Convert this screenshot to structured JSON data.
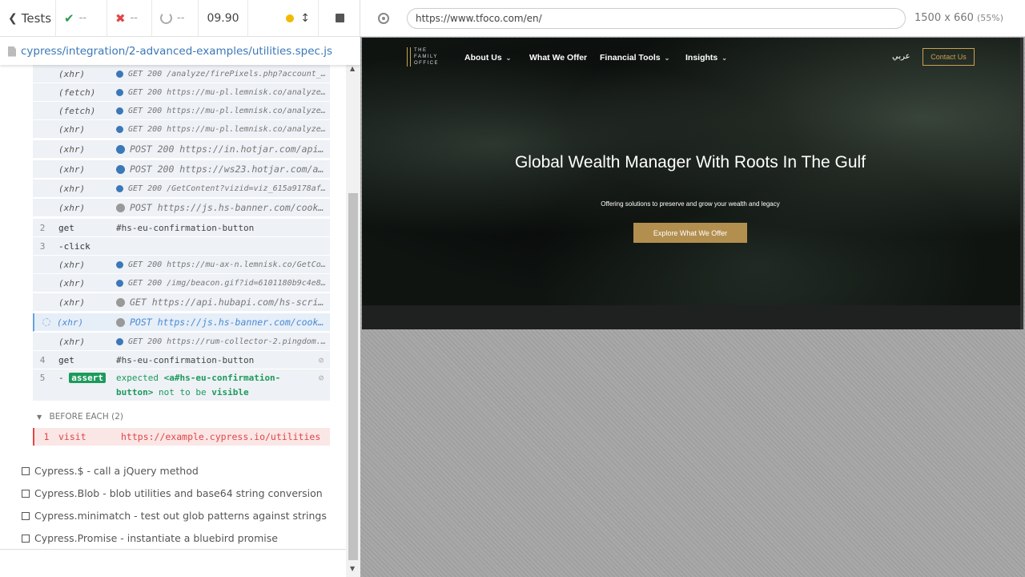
{
  "topbar": {
    "back_label": "Tests",
    "passed": "--",
    "failed": "--",
    "pending": "--",
    "duration": "09.90"
  },
  "spec": {
    "path": "cypress/integration/2-advanced-examples/utilities.spec.js"
  },
  "commands": [
    {
      "name": "(xhr)",
      "message": "GET 200 /analyze/firePixels.php?account_i…",
      "dot": "blue"
    },
    {
      "name": "(fetch)",
      "message": "GET 200 https://mu-pl.lemnisk.co/analyze/…",
      "dot": "blue"
    },
    {
      "name": "(fetch)",
      "message": "GET 200 https://mu-pl.lemnisk.co/analyze/…",
      "dot": "blue"
    },
    {
      "name": "(xhr)",
      "message": "GET 200 https://mu-pl.lemnisk.co/analyze/…",
      "dot": "blue"
    },
    {
      "name": "(xhr)",
      "message": "POST 200 https://in.hotjar.com/api…",
      "dot": "blue"
    },
    {
      "name": "(xhr)",
      "message": "POST 200 https://ws23.hotjar.com/a…",
      "dot": "blue"
    },
    {
      "name": "(xhr)",
      "message": "GET 200 /GetContent?vizid=viz_615a9178af5…",
      "dot": "blue"
    },
    {
      "name": "(xhr)",
      "message": "POST https://js.hs-banner.com/cook…",
      "dot": "grey"
    },
    {
      "num": "2",
      "name": "get",
      "message": "#hs-eu-confirmation-button"
    },
    {
      "num": "3",
      "name": "-click",
      "message": ""
    },
    {
      "name": "(xhr)",
      "message": "GET 200 https://mu-ax-n.lemnisk.co/GetCon…",
      "dot": "blue"
    },
    {
      "name": "(xhr)",
      "message": "GET 200 /img/beacon.gif?id=6101180b9c4e8d…",
      "dot": "blue"
    },
    {
      "name": "(xhr)",
      "message": "GET https://api.hubapi.com/hs-scri…",
      "dot": "grey"
    },
    {
      "name": "(xhr)",
      "message": "POST https://js.hs-banner.com/cook…",
      "dot": "grey"
    },
    {
      "name": "(xhr)",
      "message": "GET 200 https://rum-collector-2.pingdom.n…",
      "dot": "blue"
    },
    {
      "num": "4",
      "name": "get",
      "message": "#hs-eu-confirmation-button"
    }
  ],
  "assert_row": {
    "num": "5",
    "dash": "-",
    "badge": "assert",
    "w1": "expected",
    "w2": "<a#hs-eu-confirmation-",
    "w3": "button>",
    "w4": "not to be",
    "w5": "visible"
  },
  "before_each": {
    "label": "BEFORE EACH (2)"
  },
  "visit_row": {
    "num": "1",
    "name": "visit",
    "url": "https://example.cypress.io/utilities"
  },
  "tests": [
    "Cypress.$ - call a jQuery method",
    "Cypress.Blob - blob utilities and base64 string conversion",
    "Cypress.minimatch - test out glob patterns against strings",
    "Cypress.Promise - instantiate a bluebird promise"
  ],
  "browser": {
    "url": "https://www.tfoco.com/en/",
    "viewport": "1500 x 660",
    "scale": "(55%)"
  },
  "site": {
    "logo_lines": [
      "THE",
      "FAMILY",
      "OFFICE"
    ],
    "nav": [
      "About Us",
      "What We Offer",
      "Financial Tools",
      "Insights"
    ],
    "arabic": "عربي",
    "contact": "Contact Us",
    "hero_title": "Global Wealth Manager With Roots In The Gulf",
    "hero_subtitle": "Offering solutions to preserve and grow your wealth and legacy",
    "hero_cta": "Explore What We Offer"
  },
  "colors": {
    "accent_gold": "#c9a24e",
    "cta_gold": "#b38f4f",
    "pass_green": "#2a9c4d",
    "fail_red": "#e24545",
    "link_blue": "#3a78b8"
  }
}
